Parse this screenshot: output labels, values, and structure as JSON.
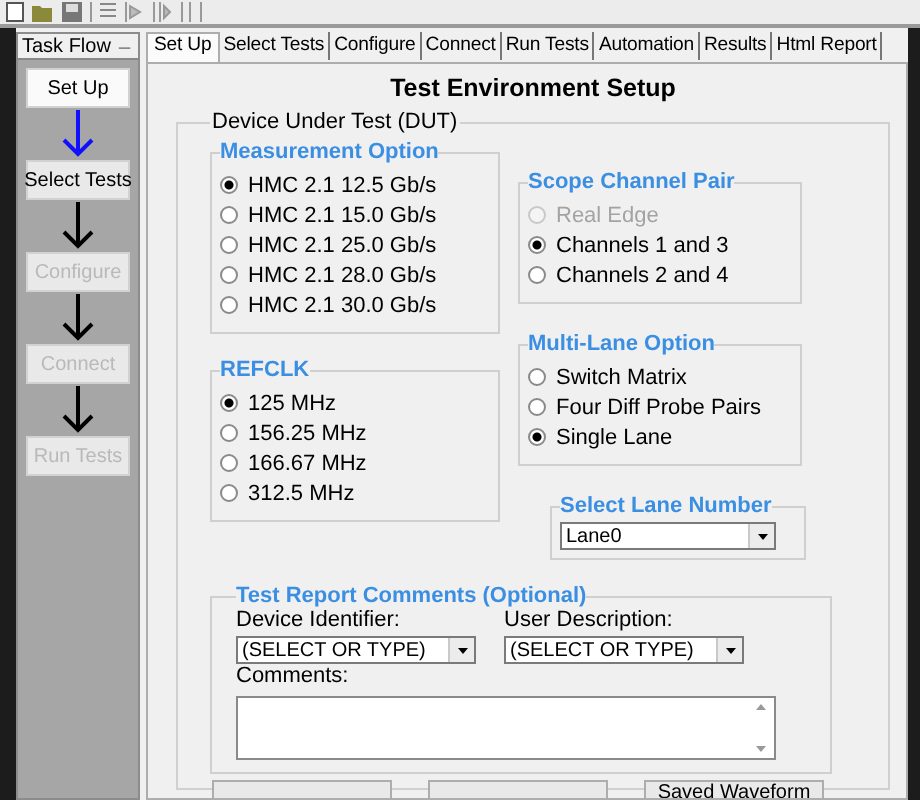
{
  "task_flow": {
    "title": "Task Flow",
    "minimize_glyph": "_",
    "steps": [
      {
        "label": "Set Up",
        "selected": true,
        "disabled": false
      },
      {
        "label": "Select Tests",
        "selected": false,
        "disabled": false
      },
      {
        "label": "Configure",
        "selected": false,
        "disabled": true
      },
      {
        "label": "Connect",
        "selected": false,
        "disabled": true
      },
      {
        "label": "Run Tests",
        "selected": false,
        "disabled": true
      }
    ]
  },
  "tabs": [
    {
      "label": "Set Up",
      "selected": true
    },
    {
      "label": "Select Tests",
      "selected": false
    },
    {
      "label": "Configure",
      "selected": false
    },
    {
      "label": "Connect",
      "selected": false
    },
    {
      "label": "Run Tests",
      "selected": false
    },
    {
      "label": "Automation",
      "selected": false
    },
    {
      "label": "Results",
      "selected": false
    },
    {
      "label": "Html Report",
      "selected": false
    }
  ],
  "page_title": "Test Environment Setup",
  "dut": {
    "legend": "Device Under Test (DUT)",
    "measurement_option": {
      "legend": "Measurement Option",
      "options": [
        {
          "label": "HMC 2.1 12.5 Gb/s",
          "selected": true,
          "disabled": false
        },
        {
          "label": "HMC 2.1 15.0 Gb/s",
          "selected": false,
          "disabled": false
        },
        {
          "label": "HMC 2.1 25.0 Gb/s",
          "selected": false,
          "disabled": false
        },
        {
          "label": "HMC 2.1 28.0 Gb/s",
          "selected": false,
          "disabled": false
        },
        {
          "label": "HMC 2.1 30.0 Gb/s",
          "selected": false,
          "disabled": false
        }
      ]
    },
    "refclk": {
      "legend": "REFCLK",
      "options": [
        {
          "label": "125 MHz",
          "selected": true,
          "disabled": false
        },
        {
          "label": "156.25 MHz",
          "selected": false,
          "disabled": false
        },
        {
          "label": "166.67 MHz",
          "selected": false,
          "disabled": false
        },
        {
          "label": "312.5 MHz",
          "selected": false,
          "disabled": false
        }
      ]
    },
    "scope_channel_pair": {
      "legend": "Scope Channel Pair",
      "options": [
        {
          "label": "Real Edge",
          "selected": false,
          "disabled": true
        },
        {
          "label": "Channels 1 and 3",
          "selected": true,
          "disabled": false
        },
        {
          "label": "Channels 2 and 4",
          "selected": false,
          "disabled": false
        }
      ]
    },
    "multi_lane_option": {
      "legend": "Multi-Lane Option",
      "options": [
        {
          "label": "Switch Matrix",
          "selected": false,
          "disabled": false
        },
        {
          "label": "Four Diff Probe Pairs",
          "selected": false,
          "disabled": false
        },
        {
          "label": "Single Lane",
          "selected": true,
          "disabled": false
        }
      ]
    },
    "lane_select": {
      "legend": "Select Lane Number",
      "value": "Lane0"
    },
    "test_report_comments": {
      "legend": "Test Report Comments (Optional)",
      "device_identifier": {
        "label": "Device Identifier:",
        "value": "(SELECT OR TYPE)"
      },
      "user_description": {
        "label": "User Description:",
        "value": "(SELECT OR TYPE)"
      },
      "comments": {
        "label": "Comments:"
      }
    },
    "buttons": [
      {
        "kind": "blank"
      },
      {
        "kind": "blank"
      },
      {
        "kind": "text",
        "label": "Saved Waveform"
      }
    ]
  }
}
